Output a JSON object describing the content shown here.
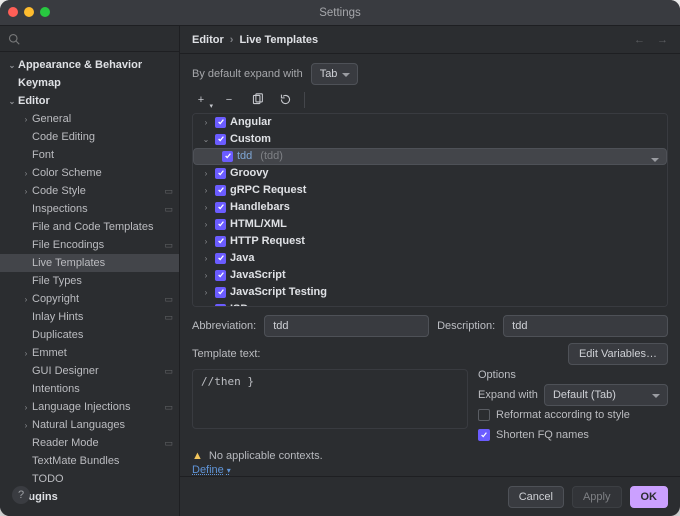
{
  "window": {
    "title": "Settings"
  },
  "crumbs": [
    "Editor",
    "Live Templates"
  ],
  "sidebar": {
    "items": [
      {
        "label": "Appearance & Behavior",
        "depth": 0,
        "exp": true,
        "bold": true,
        "pin": false
      },
      {
        "label": "Keymap",
        "depth": 0,
        "exp": null,
        "bold": true,
        "pin": false
      },
      {
        "label": "Editor",
        "depth": 0,
        "exp": true,
        "bold": true,
        "pin": false
      },
      {
        "label": "General",
        "depth": 1,
        "exp": false,
        "bold": false,
        "pin": false
      },
      {
        "label": "Code Editing",
        "depth": 1,
        "exp": null,
        "bold": false,
        "pin": false
      },
      {
        "label": "Font",
        "depth": 1,
        "exp": null,
        "bold": false,
        "pin": false
      },
      {
        "label": "Color Scheme",
        "depth": 1,
        "exp": false,
        "bold": false,
        "pin": false
      },
      {
        "label": "Code Style",
        "depth": 1,
        "exp": false,
        "bold": false,
        "pin": true
      },
      {
        "label": "Inspections",
        "depth": 1,
        "exp": null,
        "bold": false,
        "pin": true
      },
      {
        "label": "File and Code Templates",
        "depth": 1,
        "exp": null,
        "bold": false,
        "pin": false
      },
      {
        "label": "File Encodings",
        "depth": 1,
        "exp": null,
        "bold": false,
        "pin": true
      },
      {
        "label": "Live Templates",
        "depth": 1,
        "exp": null,
        "bold": false,
        "pin": false,
        "selected": true
      },
      {
        "label": "File Types",
        "depth": 1,
        "exp": null,
        "bold": false,
        "pin": false
      },
      {
        "label": "Copyright",
        "depth": 1,
        "exp": false,
        "bold": false,
        "pin": true
      },
      {
        "label": "Inlay Hints",
        "depth": 1,
        "exp": null,
        "bold": false,
        "pin": true
      },
      {
        "label": "Duplicates",
        "depth": 1,
        "exp": null,
        "bold": false,
        "pin": false
      },
      {
        "label": "Emmet",
        "depth": 1,
        "exp": false,
        "bold": false,
        "pin": false
      },
      {
        "label": "GUI Designer",
        "depth": 1,
        "exp": null,
        "bold": false,
        "pin": true
      },
      {
        "label": "Intentions",
        "depth": 1,
        "exp": null,
        "bold": false,
        "pin": false
      },
      {
        "label": "Language Injections",
        "depth": 1,
        "exp": false,
        "bold": false,
        "pin": true
      },
      {
        "label": "Natural Languages",
        "depth": 1,
        "exp": false,
        "bold": false,
        "pin": false
      },
      {
        "label": "Reader Mode",
        "depth": 1,
        "exp": null,
        "bold": false,
        "pin": true
      },
      {
        "label": "TextMate Bundles",
        "depth": 1,
        "exp": null,
        "bold": false,
        "pin": false
      },
      {
        "label": "TODO",
        "depth": 1,
        "exp": null,
        "bold": false,
        "pin": false
      },
      {
        "label": "Plugins",
        "depth": 0,
        "exp": null,
        "bold": true,
        "pin": false
      }
    ]
  },
  "expand": {
    "label": "By default expand with",
    "value": "Tab"
  },
  "templates": {
    "groups": [
      {
        "label": "Angular",
        "exp": false
      },
      {
        "label": "Custom",
        "exp": true,
        "children": [
          {
            "label": "tdd",
            "hint": "(tdd)",
            "selected": true
          }
        ]
      },
      {
        "label": "Groovy",
        "exp": false
      },
      {
        "label": "gRPC Request",
        "exp": false
      },
      {
        "label": "Handlebars",
        "exp": false
      },
      {
        "label": "HTML/XML",
        "exp": false
      },
      {
        "label": "HTTP Request",
        "exp": false
      },
      {
        "label": "Java",
        "exp": false
      },
      {
        "label": "JavaScript",
        "exp": false
      },
      {
        "label": "JavaScript Testing",
        "exp": false
      },
      {
        "label": "ISD",
        "exp": true
      }
    ]
  },
  "detail": {
    "abbrev_label": "Abbreviation:",
    "abbrev": "tdd",
    "desc_label": "Description:",
    "desc": "tdd",
    "template_label": "Template text:",
    "template_lines": [
      "    //then",
      "}"
    ],
    "edit_vars": "Edit Variables…",
    "options_title": "Options",
    "expand_with_label": "Expand with",
    "expand_with_value": "Default (Tab)",
    "reformat_label": "Reformat according to style",
    "reformat_checked": false,
    "shorten_label": "Shorten FQ names",
    "shorten_checked": true,
    "warn_text": "No applicable contexts.",
    "define": "Define"
  },
  "footer": {
    "cancel": "Cancel",
    "apply": "Apply",
    "ok": "OK"
  }
}
